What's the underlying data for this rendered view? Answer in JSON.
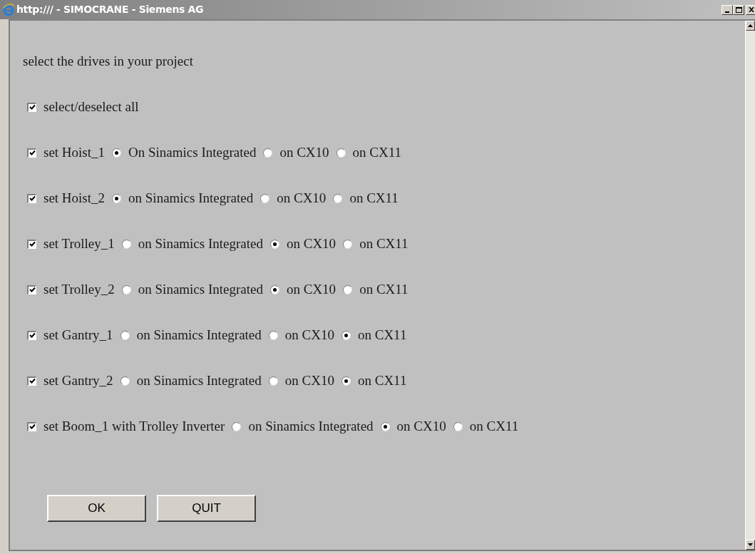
{
  "window": {
    "title": "http:/// - SIMOCRANE - Siemens AG"
  },
  "heading": "select the drives in your project",
  "select_all": {
    "label": "select/deselect all",
    "checked": true
  },
  "drives": [
    {
      "label": "set Hoist_1",
      "checked": true,
      "options": [
        {
          "label": "On Sinamics Integrated",
          "selected": true
        },
        {
          "label": "on CX10",
          "selected": false
        },
        {
          "label": "on CX11",
          "selected": false
        }
      ]
    },
    {
      "label": "set Hoist_2",
      "checked": true,
      "options": [
        {
          "label": "on Sinamics Integrated",
          "selected": true
        },
        {
          "label": "on CX10",
          "selected": false
        },
        {
          "label": "on CX11",
          "selected": false
        }
      ]
    },
    {
      "label": "set Trolley_1",
      "checked": true,
      "options": [
        {
          "label": "on Sinamics Integrated",
          "selected": false
        },
        {
          "label": "on CX10",
          "selected": true
        },
        {
          "label": "on CX11",
          "selected": false
        }
      ]
    },
    {
      "label": "set Trolley_2",
      "checked": true,
      "options": [
        {
          "label": "on Sinamics Integrated",
          "selected": false
        },
        {
          "label": "on CX10",
          "selected": true
        },
        {
          "label": "on CX11",
          "selected": false
        }
      ]
    },
    {
      "label": "set Gantry_1",
      "checked": true,
      "options": [
        {
          "label": "on Sinamics Integrated",
          "selected": false
        },
        {
          "label": "on CX10",
          "selected": false
        },
        {
          "label": "on CX11",
          "selected": true
        }
      ]
    },
    {
      "label": "set Gantry_2",
      "checked": true,
      "options": [
        {
          "label": "on Sinamics Integrated",
          "selected": false
        },
        {
          "label": "on CX10",
          "selected": false
        },
        {
          "label": "on CX11",
          "selected": true
        }
      ]
    },
    {
      "label": "set Boom_1 with Trolley Inverter",
      "checked": true,
      "options": [
        {
          "label": "on Sinamics Integrated",
          "selected": false
        },
        {
          "label": "on CX10",
          "selected": true
        },
        {
          "label": "on CX11",
          "selected": false
        }
      ]
    }
  ],
  "buttons": [
    "OK",
    "QUIT"
  ]
}
